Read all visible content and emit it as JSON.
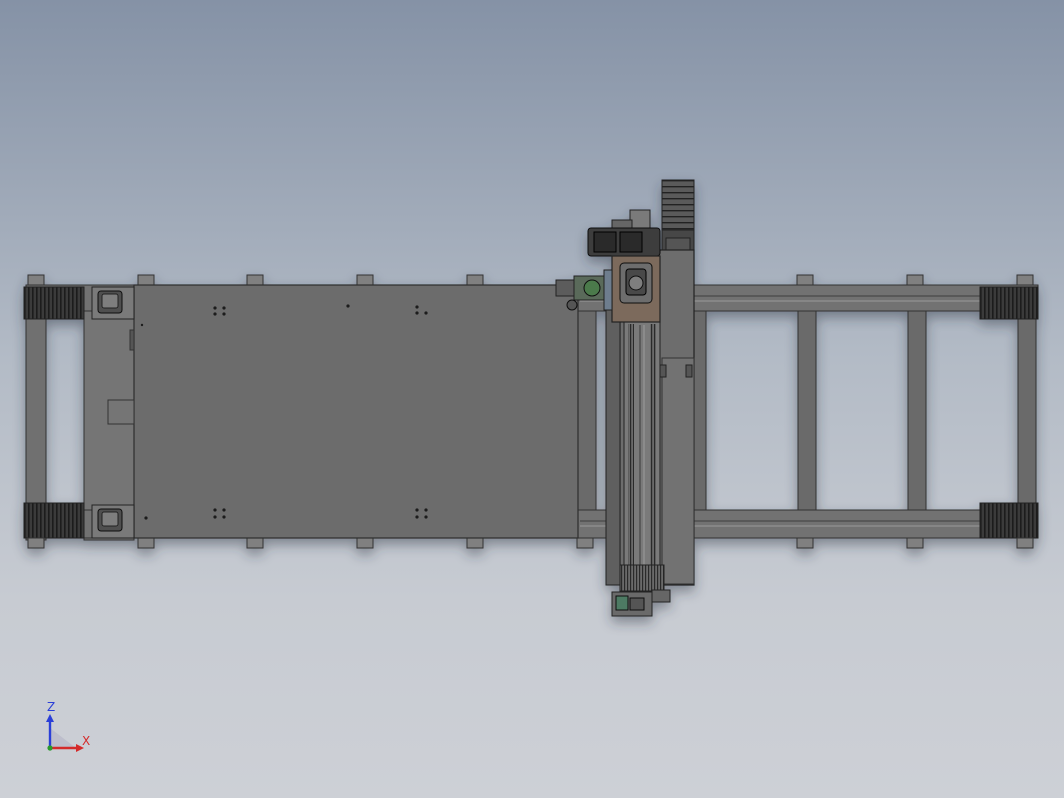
{
  "viewport": {
    "background_top": "#8592a6",
    "background_bottom": "#cdd0d6",
    "model_color": "#6e6e6e"
  },
  "triad": {
    "z_label": "Z",
    "x_label": "X",
    "z_color": "#2a3fd8",
    "x_color": "#d42a2a",
    "y_color": "#2a9a2a"
  }
}
